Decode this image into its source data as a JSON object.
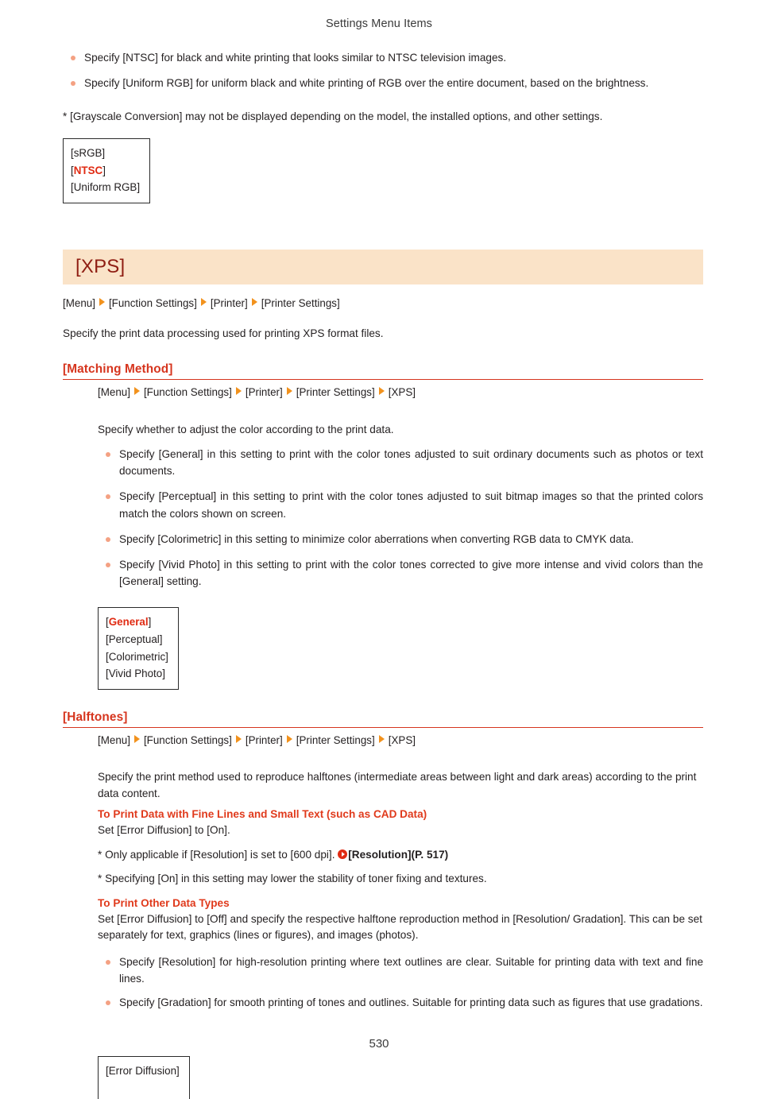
{
  "header": {
    "title": "Settings Menu Items"
  },
  "page_number": "530",
  "colors": {
    "banner_bg": "#fae3c8",
    "banner_text": "#8f1d12",
    "section_red": "#d6351e",
    "default_value_red": "#e02b13",
    "bullet": "#f4a183",
    "crumb_arrow": "#f2921d"
  },
  "top_section": {
    "bullets": [
      "Specify [NTSC] for black and white printing that looks similar to NTSC television images.",
      "Specify [Uniform RGB] for uniform black and white printing of RGB over the entire document, based on the brightness."
    ],
    "note": "* [Grayscale Conversion] may not be displayed depending on the model, the installed options, and other settings.",
    "value_box": [
      {
        "text": "[sRGB]",
        "default": false
      },
      {
        "text": "[NTSC]",
        "default": true,
        "open": "[",
        "value": "NTSC",
        "close": "]"
      },
      {
        "text": "[Uniform RGB]",
        "default": false
      }
    ]
  },
  "xps_section": {
    "banner_title": "[XPS]",
    "breadcrumb": [
      "[Menu]",
      "[Function Settings]",
      "[Printer]",
      "[Printer Settings]"
    ],
    "description": "Specify the print data processing used for printing XPS format files."
  },
  "matching_method": {
    "heading": "[Matching Method]",
    "breadcrumb": [
      "[Menu]",
      "[Function Settings]",
      "[Printer]",
      "[Printer Settings]",
      "[XPS]"
    ],
    "intro": "Specify whether to adjust the color according to the print data.",
    "bullets": [
      "Specify [General] in this setting to print with the color tones adjusted to suit ordinary documents such as photos or text documents.",
      "Specify [Perceptual] in this setting to print with the color tones adjusted to suit bitmap images so that the printed colors match the colors shown on screen.",
      "Specify [Colorimetric] in this setting to minimize color aberrations when converting RGB data to CMYK data.",
      "Specify [Vivid Photo] in this setting to print with the color tones corrected to give more intense and vivid colors than the [General] setting."
    ],
    "value_box": [
      {
        "text": "[General]",
        "default": true,
        "open": "[",
        "value": "General",
        "close": "]"
      },
      {
        "text": "[Perceptual]",
        "default": false
      },
      {
        "text": "[Colorimetric]",
        "default": false
      },
      {
        "text": "[Vivid Photo]",
        "default": false
      }
    ]
  },
  "halftones": {
    "heading": "[Halftones]",
    "breadcrumb": [
      "[Menu]",
      "[Function Settings]",
      "[Printer]",
      "[Printer Settings]",
      "[XPS]"
    ],
    "intro": "Specify the print method used to reproduce halftones (intermediate areas between light and dark areas) according to the print data content.",
    "fine_lines": {
      "lead": "To Print Data with Fine Lines and Small Text (such as CAD Data)",
      "line1": "Set [Error Diffusion] to [On].",
      "note1_prefix": "* Only applicable if [Resolution] is set to [600 dpi].",
      "note1_link": "[Resolution](P. 517)",
      "note2": "* Specifying [On] in this setting may lower the stability of toner fixing and textures."
    },
    "other_types": {
      "lead": "To Print Other Data Types",
      "line1": "Set [Error Diffusion] to [Off] and specify the respective halftone reproduction method in [Resolution/ Gradation]. This can be set separately for text, graphics (lines or figures), and images (photos).",
      "bullets": [
        "Specify [Resolution] for high-resolution printing where text outlines are clear. Suitable for printing data with text and fine lines.",
        "Specify [Gradation] for smooth printing of tones and outlines. Suitable for printing data such as figures that use gradations."
      ]
    },
    "value_box": [
      {
        "text": "[Error Diffusion]",
        "default": false
      }
    ]
  }
}
